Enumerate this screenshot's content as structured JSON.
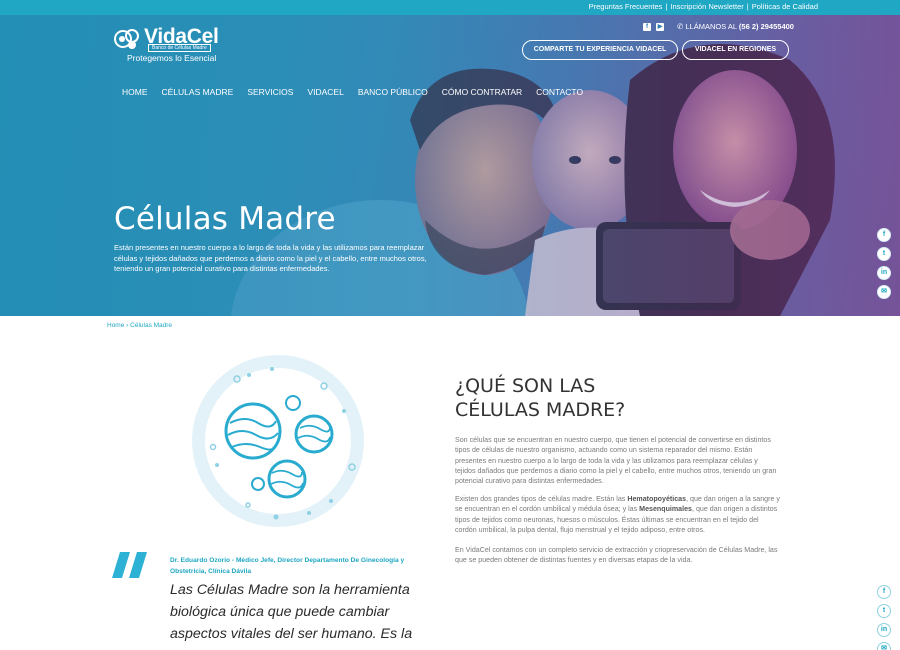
{
  "colors": {
    "accent": "#1fa7c3",
    "heading": "#333333",
    "body": "#7a7a7a"
  },
  "topbar": {
    "links": [
      "Preguntas Frecuentes",
      "Inscripción Newsletter",
      "Políticas de Calidad"
    ],
    "separator": "|"
  },
  "header": {
    "logo_name": "VidaCel",
    "logo_sub": "Banco de Células Madre",
    "logo_tagline": "Protegemos lo Esencial",
    "social_icons": [
      "facebook-icon",
      "youtube-icon"
    ],
    "phone_prefix": "LLÁMANOS AL",
    "phone_number": "(56 2) 29455400",
    "cta_experience": "COMPARTE TU EXPERIENCIA VIDACEL",
    "cta_regions": "VIDACEL EN REGIONES"
  },
  "nav": {
    "items": [
      "HOME",
      "CÉLULAS MADRE",
      "SERVICIOS",
      "VIDACEL",
      "BANCO PÚBLICO",
      "CÓMO CONTRATAR",
      "CONTACTO"
    ]
  },
  "hero": {
    "title": "Células Madre",
    "description": "Están presentes en nuestro cuerpo a lo largo de toda la vida y las utilizamos para reemplazar células y tejidos dañados que perdemos a diario como la piel y el cabello, entre muchos otros, teniendo un gran potencial curativo para distintas enfermedades."
  },
  "floating_social": {
    "icons": [
      "facebook-icon",
      "twitter-icon",
      "linkedin-icon",
      "email-icon"
    ],
    "glyphs": [
      "f",
      "t",
      "in",
      "✉"
    ]
  },
  "breadcrumb": {
    "home": "Home",
    "separator": "›",
    "current": "Células Madre"
  },
  "content": {
    "heading_line1": "¿QUÉ SON LAS",
    "heading_line2": "CÉLULAS MADRE?",
    "p1": "Son células que se encuentran en nuestro cuerpo, que tienen el potencial de convertirse en distintos tipos de células de nuestro organismo, actuando como un sistema reparador del mismo. Están presentes en nuestro cuerpo a lo largo de toda la vida y las utilizamos para reemplazar células y tejidos dañados que perdemos a diario como la piel y el cabello, entre muchos otros, teniendo un gran potencial curativo para distintas enfermedades.",
    "p2_a": "Existen dos grandes tipos de células madre. Están las ",
    "p2_b": "Hematopoyéticas",
    "p2_c": ", que dan origen a la sangre y se encuentran en el cordón umbilical y médula ósea; y las ",
    "p2_d": "Mesenquimales",
    "p2_e": ", que dan origen a distintos tipos de tejidos como neuronas, huesos o músculos. Éstas últimas se encuentran en el tejido del cordón umbilical, la pulpa dental, flujo menstrual y el tejido adiposo, entre otros.",
    "p3": "En VidaCel contamos con un completo servicio de extracción y criopreservación de Células Madre, las que se pueden obtener de distintas fuentes y en diversas etapas de la vida."
  },
  "quote": {
    "author": "Dr. Eduardo Ozorio - Médico Jefe, Director Departamento De Ginecología y Obstetricia, Clínica Dávila",
    "text": "Las Células Madre son la herramienta biológica única que puede cambiar aspectos vitales del ser humano. Es la única forma de prolongar la vida"
  }
}
